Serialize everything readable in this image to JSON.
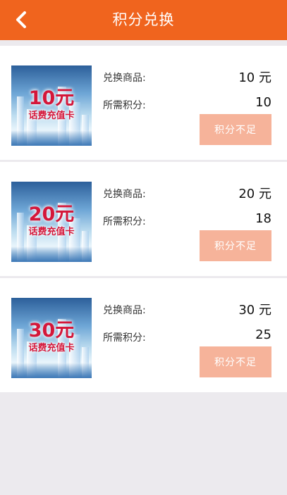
{
  "header": {
    "title": "积分兑换",
    "back_icon": "chevron-left-icon"
  },
  "colors": {
    "header_bg": "#f0641e",
    "button_disabled_bg": "#f6b39a",
    "page_bg": "#eceaee",
    "card_image_text": "#d4173a"
  },
  "items": [
    {
      "image_amount": "10元",
      "image_subtitle": "话费充值卡",
      "product_label": "兑换商品:",
      "product_value": "10 元",
      "points_label": "所需积分:",
      "points_value": "10",
      "button_label": "积分不足"
    },
    {
      "image_amount": "20元",
      "image_subtitle": "话费充值卡",
      "product_label": "兑换商品:",
      "product_value": "20 元",
      "points_label": "所需积分:",
      "points_value": "18",
      "button_label": "积分不足"
    },
    {
      "image_amount": "30元",
      "image_subtitle": "话费充值卡",
      "product_label": "兑换商品:",
      "product_value": "30 元",
      "points_label": "所需积分:",
      "points_value": "25",
      "button_label": "积分不足"
    }
  ]
}
